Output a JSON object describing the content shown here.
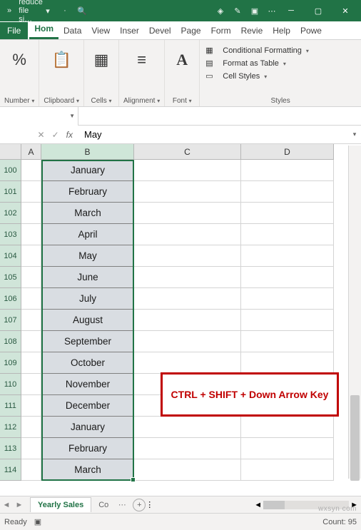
{
  "titlebar": {
    "filename": "reduce file si…",
    "chevrons": "»"
  },
  "tabs": {
    "file": "File",
    "list": [
      "Hom",
      "Data",
      "View",
      "Inser",
      "Devel",
      "Page",
      "Form",
      "Revie",
      "Help",
      "Powe"
    ],
    "active_index": 0
  },
  "ribbon": {
    "number": "Number",
    "clipboard": "Clipboard",
    "cells": "Cells",
    "alignment": "Alignment",
    "font": "Font",
    "styles_label": "Styles",
    "cond_format": "Conditional Formatting",
    "format_table": "Format as Table",
    "cell_styles": "Cell Styles"
  },
  "formula": {
    "fx": "fx",
    "value": "May"
  },
  "columns": [
    "A",
    "B",
    "C",
    "D"
  ],
  "rows": [
    {
      "num": "100",
      "val": "January"
    },
    {
      "num": "101",
      "val": "February"
    },
    {
      "num": "102",
      "val": "March"
    },
    {
      "num": "103",
      "val": "April"
    },
    {
      "num": "104",
      "val": "May"
    },
    {
      "num": "105",
      "val": "June"
    },
    {
      "num": "106",
      "val": "July"
    },
    {
      "num": "107",
      "val": "August"
    },
    {
      "num": "108",
      "val": "September"
    },
    {
      "num": "109",
      "val": "October"
    },
    {
      "num": "110",
      "val": "November"
    },
    {
      "num": "111",
      "val": "December"
    },
    {
      "num": "112",
      "val": "January"
    },
    {
      "num": "113",
      "val": "February"
    },
    {
      "num": "114",
      "val": "March"
    }
  ],
  "callout": "CTRL + SHIFT + Down Arrow Key",
  "sheets": {
    "active": "Yearly Sales",
    "next": "Co"
  },
  "status": {
    "ready": "Ready",
    "count_label": "Count:",
    "count_val": "95"
  },
  "watermark": "wxsyn com"
}
